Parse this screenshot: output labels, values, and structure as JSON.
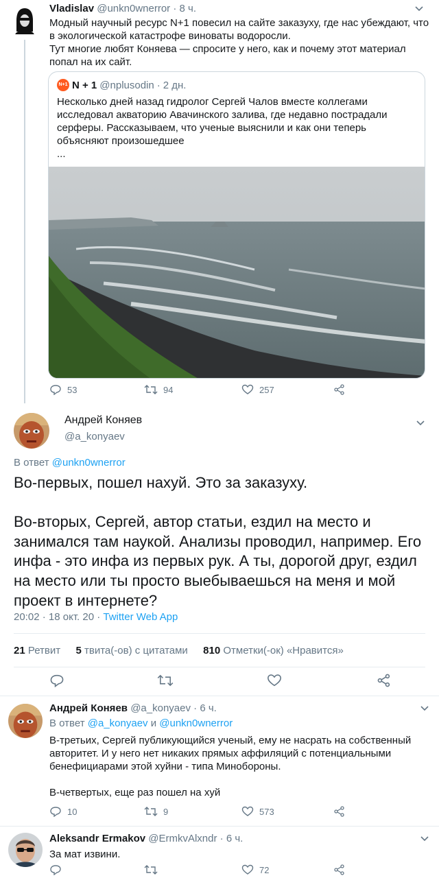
{
  "tweet1": {
    "name": "Vladislav",
    "handle": "@unkn0wnerror",
    "sep": "·",
    "time": "8 ч.",
    "text": "Модный научный ресурс N+1 повесил на сайте заказуху, где нас убеждают, что в экологической катастрофе виноваты водоросли.\nТут многие любят Коняева — спросите у него, как и почему этот материал попал на их сайт.",
    "quoted": {
      "badge": "N+1",
      "name": "N + 1",
      "handle": "@nplusodin",
      "sep": "·",
      "time": "2 дн.",
      "text": "Несколько дней назад гидролог Сергей Чалов вместе коллегами исследовал акваторию Авачинского залива, где недавно пострадали серферы. Рассказываем, что ученые выяснили и как они теперь объясняют произошедшее\n..."
    },
    "replies": "53",
    "retweets": "94",
    "likes": "257"
  },
  "main": {
    "name": "Андрей Коняев",
    "handle": "@a_konyaev",
    "reply_prefix": "В ответ",
    "reply_to": "@unkn0wnerror",
    "text": "Во-первых, пошел нахуй. Это за заказуху.\n\nВо-вторых, Сергей, автор статьи, ездил на место и занимался там наукой. Анализы проводил, например. Его инфа - это инфа из первых рук. А ты, дорогой друг, ездил на место или ты просто выебываешься на меня и мой проект в интернете?",
    "time": "20:02",
    "date": "18 окт. 20",
    "sep": "·",
    "source": "Twitter Web App",
    "stats": {
      "retweets_count": "21",
      "retweets_label": "Ретвит",
      "quotes_count": "5",
      "quotes_label": "твита(-ов) с цитатами",
      "likes_count": "810",
      "likes_label": "Отметки(-ок) «Нравится»"
    }
  },
  "reply1": {
    "name": "Андрей Коняев",
    "handle": "@a_konyaev",
    "sep": "·",
    "time": "6 ч.",
    "reply_prefix": "В ответ",
    "reply_to_1": "@a_konyaev",
    "reply_and": "и",
    "reply_to_2": "@unkn0wnerror",
    "text": "В-третьих, Сергей публикующийся ученый, ему не насрать на собственный авторитет. И у него нет никаких прямых аффиляций с потенциальными бенефициарами этой хуйни - типа Минобороны.\n\nВ-четвертых, еще раз пошел на хуй",
    "replies": "10",
    "retweets": "9",
    "likes": "573"
  },
  "reply2": {
    "name": "Aleksandr Ermakov",
    "handle": "@ErmkvAlxndr",
    "sep": "·",
    "time": "6 ч.",
    "text": "За мат извини.",
    "likes": "72"
  },
  "colors": {
    "accent": "#1da1f2",
    "muted": "#657786",
    "divider": "#e6ecf0"
  }
}
